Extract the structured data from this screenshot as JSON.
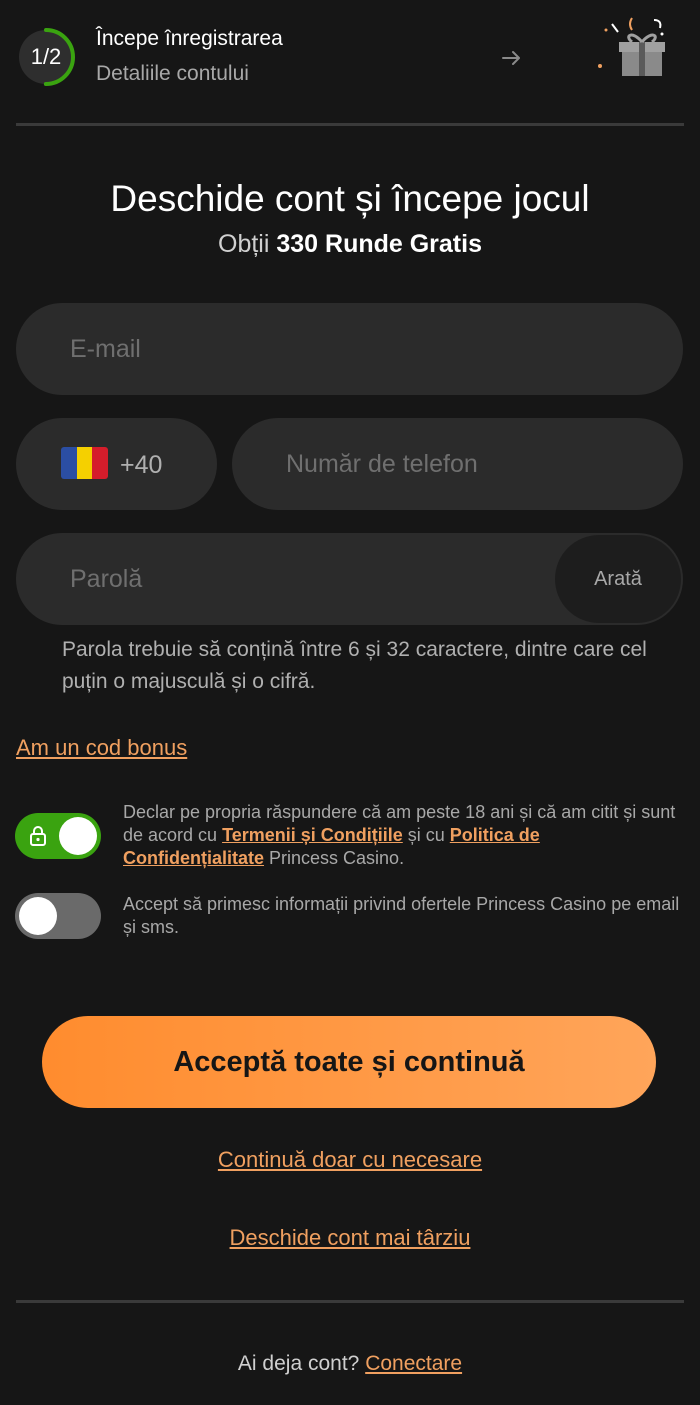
{
  "header": {
    "step": "1/2",
    "progress": 0.5,
    "title": "Începe înregistrarea",
    "subtitle": "Detaliile contului",
    "arrow_icon": "arrow-right-icon",
    "gift_icon": "gift-icon"
  },
  "main": {
    "title": "Deschide cont și începe jocul",
    "subtitle_prefix": "Obții ",
    "subtitle_bold": "330 Runde Gratis"
  },
  "form": {
    "email_placeholder": "E-mail",
    "country_code": "+40",
    "flag_colors": [
      "#2b4ea3",
      "#f5d000",
      "#d51d2b"
    ],
    "phone_placeholder": "Număr de telefon",
    "password_placeholder": "Parolă",
    "show_label": "Arată",
    "password_hint": "Parola trebuie să conțină între 6 și 32 caractere, dintre care cel puțin o majusculă și o cifră."
  },
  "bonus_link": "Am un cod bonus",
  "consents": {
    "terms": {
      "checked": true,
      "text_1": "Declar pe propria răspundere că am peste 18 ani și că am citit și sunt de acord cu ",
      "link_terms": "Termenii și Condițiile",
      "text_2": " și cu ",
      "link_privacy": "Politica de Confidențialitate",
      "text_3": " Princess Casino."
    },
    "marketing": {
      "checked": false,
      "text": "Accept să primesc informații privind ofertele Princess Casino pe email și sms."
    }
  },
  "actions": {
    "accept_all": "Acceptă toate și continuă",
    "necessary_only": "Continuă doar cu necesare",
    "later": "Deschide cont mai târziu"
  },
  "footer": {
    "question": "Ai deja cont? ",
    "login_link": "Conectare"
  },
  "colors": {
    "background": "#161616",
    "accent": "#ff8c2e",
    "link": "#f0a060",
    "toggle_on": "#3aa310"
  }
}
